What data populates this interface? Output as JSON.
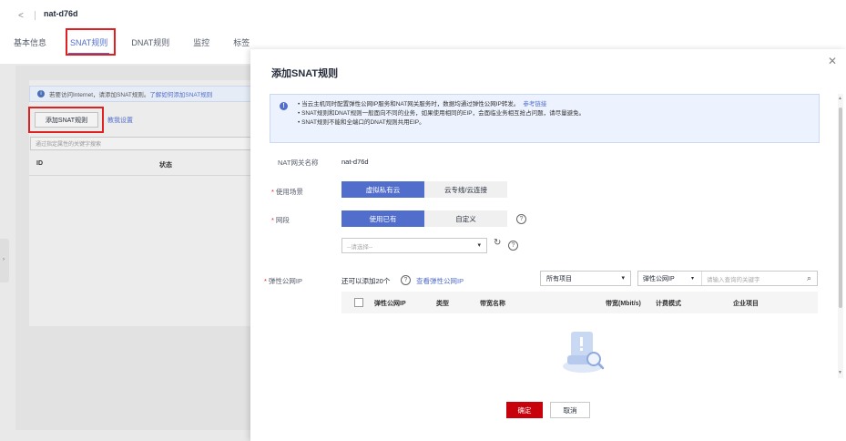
{
  "header": {
    "back_icon": "chevron-left-icon",
    "title": "nat-d76d"
  },
  "tabs": [
    {
      "label": "基本信息"
    },
    {
      "label": "SNAT规则"
    },
    {
      "label": "DNAT规则"
    },
    {
      "label": "监控"
    },
    {
      "label": "标签"
    }
  ],
  "background": {
    "info_text": "若要访问Internet，请添加SNAT规则。",
    "info_link": "了解如何添加SNAT规则",
    "add_button": "添加SNAT规则",
    "tutorial_link": "教我设置",
    "search_placeholder": "通过指定属性的关键字搜索",
    "col_id": "ID",
    "col_status": "状态"
  },
  "modal": {
    "title": "添加SNAT规则",
    "close_icon": "close-icon",
    "alert": {
      "icon": "info-icon",
      "line1": "当云主机同时配置弹性公网IP服务和NAT网关服务时，数据均通过弹性公网IP转发。",
      "line1_link": "参考链接",
      "line2": "SNAT规则和DNAT规则一般面向不同的业务，如果使用相同的EIP，会面临业务相互抢占问题，请尽量避免。",
      "line3": "SNAT规则不能和全端口的DNAT规则共用EIP。"
    },
    "gateway_label": "NAT网关名称",
    "gateway_value": "nat-d76d",
    "required_mark": "*",
    "scene_label": "使用场景",
    "scene_options": [
      "虚拟私有云",
      "云专线/云连接"
    ],
    "subnet_label": "网段",
    "subnet_options": [
      "使用已有",
      "自定义"
    ],
    "help_glyph": "?",
    "subnet_select_placeholder": "--请选择--",
    "eip_label": "弹性公网IP",
    "eip_quota": "还可以添加20个",
    "eip_view_link": "查看弹性公网IP",
    "project_select": "所有项目",
    "filter_key": "弹性公网IP",
    "filter_placeholder": "请输入查询的关键字",
    "table_columns": [
      "弹性公网IP",
      "类型",
      "带宽名称",
      "带宽(Mbit/s)",
      "计费模式",
      "企业项目"
    ],
    "confirm_button": "确定",
    "cancel_button": "取消"
  }
}
